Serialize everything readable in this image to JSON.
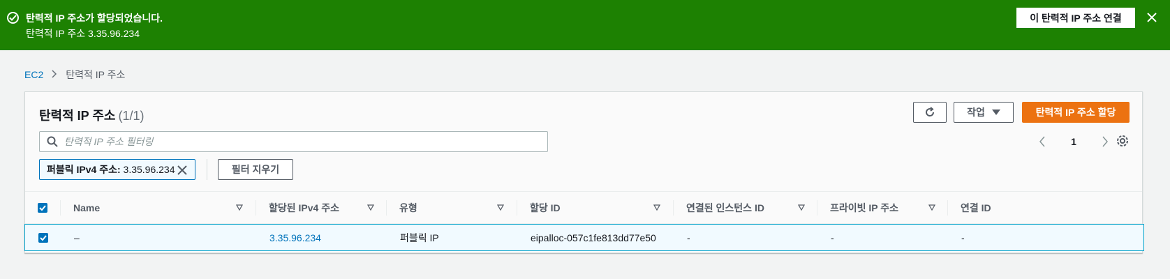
{
  "flash": {
    "title": "탄력적 IP 주소가 할당되었습니다.",
    "subtitle": "탄력적 IP 주소 3.35.96.234",
    "action_label": "이 탄력적 IP 주소 연결",
    "color": "#1d8102",
    "icons": [
      "check-circle-icon",
      "close-icon"
    ]
  },
  "breadcrumb": {
    "root": "EC2",
    "current": "탄력적 IP 주소"
  },
  "panel": {
    "title": "탄력적 IP 주소",
    "count": "(1/1)",
    "actions_label": "작업",
    "primary_label": "탄력적 IP 주소 할당",
    "primary_color": "#ec7211"
  },
  "search": {
    "placeholder": "탄력적 IP 주소 필터링",
    "value": ""
  },
  "pagination": {
    "page": "1"
  },
  "filter_token": {
    "key": "퍼블릭 IPv4 주소:",
    "value": "3.35.96.234"
  },
  "clear_filters_label": "필터 지우기",
  "table": {
    "columns": [
      "Name",
      "할당된 IPv4 주소",
      "유형",
      "할당 ID",
      "연결된 인스턴스 ID",
      "프라이빗 IP 주소",
      "연결 ID"
    ],
    "rows": [
      {
        "selected": true,
        "name": "–",
        "ipv4": "3.35.96.234",
        "type": "퍼블릭 IP",
        "allocation_id": "eipalloc-057c1fe813dd77e50",
        "instance_id": "-",
        "private_ip": "-",
        "association_id": "-"
      }
    ]
  }
}
